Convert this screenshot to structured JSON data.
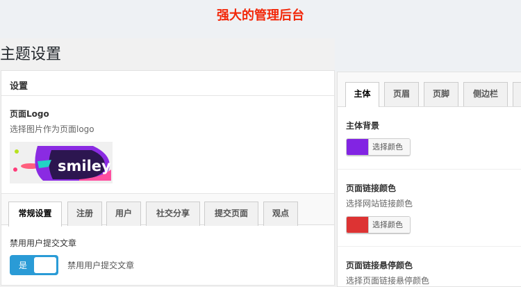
{
  "banner": "强大的管理后台",
  "page_title": "主题设置",
  "left": {
    "header": "设置",
    "logo_label": "页面Logo",
    "logo_desc": "选择图片作为页面logo",
    "logo_text": "smiley",
    "tabs": [
      "常规设置",
      "注册",
      "用户",
      "社交分享",
      "提交页面",
      "观点"
    ],
    "field_label": "禁用用户提交文章",
    "toggle_on": "是",
    "toggle_desc": "禁用用户提交文章"
  },
  "right": {
    "tabs": [
      "主体",
      "页眉",
      "页脚",
      "侧边栏"
    ],
    "body_bg_label": "主体背景",
    "body_bg_color": "#8224e3",
    "link_label": "页面链接颜色",
    "link_desc": "选择网站链接颜色",
    "link_color": "#dd3333",
    "pick_color": "选择颜色",
    "hover_label": "页面链接悬停颜色",
    "hover_desc": "选择页面链接悬停颜色"
  }
}
